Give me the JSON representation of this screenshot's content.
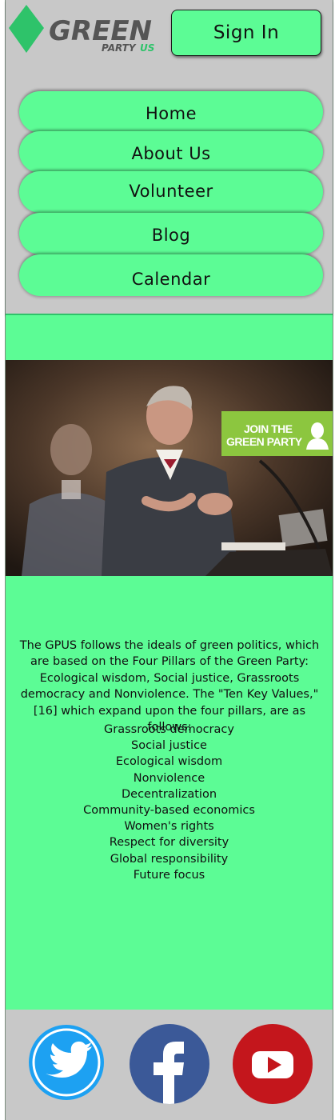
{
  "header": {
    "logo": {
      "word": "GREEN",
      "sub1": "PARTY",
      "sub2": "US"
    },
    "sign_in_label": "Sign In"
  },
  "nav": {
    "items": [
      {
        "label": "Home"
      },
      {
        "label": "About Us"
      },
      {
        "label": "Volunteer"
      },
      {
        "label": "Blog"
      },
      {
        "label": "Calendar"
      }
    ]
  },
  "hero": {
    "badge_line1": "JOIN THE",
    "badge_line2": "GREEN PARTY"
  },
  "content": {
    "intro": "The GPUS follows the ideals of green politics, which are based on the Four Pillars of the Green Party: Ecological wisdom, Social justice, Grassroots democracy and Nonviolence. The \"Ten Key Values,\"[16] which expand upon the four pillars, are as follows:",
    "values": [
      "Grassroots democracy",
      "Social justice",
      "Ecological wisdom",
      "Nonviolence",
      "Decentralization",
      "Community-based economics",
      "Women's rights",
      "Respect for diversity",
      "Global responsibility",
      "Future focus"
    ]
  },
  "footer": {
    "icons": [
      "twitter-icon",
      "facebook-icon",
      "youtube-icon"
    ]
  },
  "colors": {
    "accent": "#5cfc95",
    "panel": "#c8c8c8",
    "logo_diamond": "#2ec36a",
    "logo_text": "#555555",
    "twitter": "#1da1f2",
    "facebook": "#3b5998",
    "youtube": "#c4161c"
  }
}
